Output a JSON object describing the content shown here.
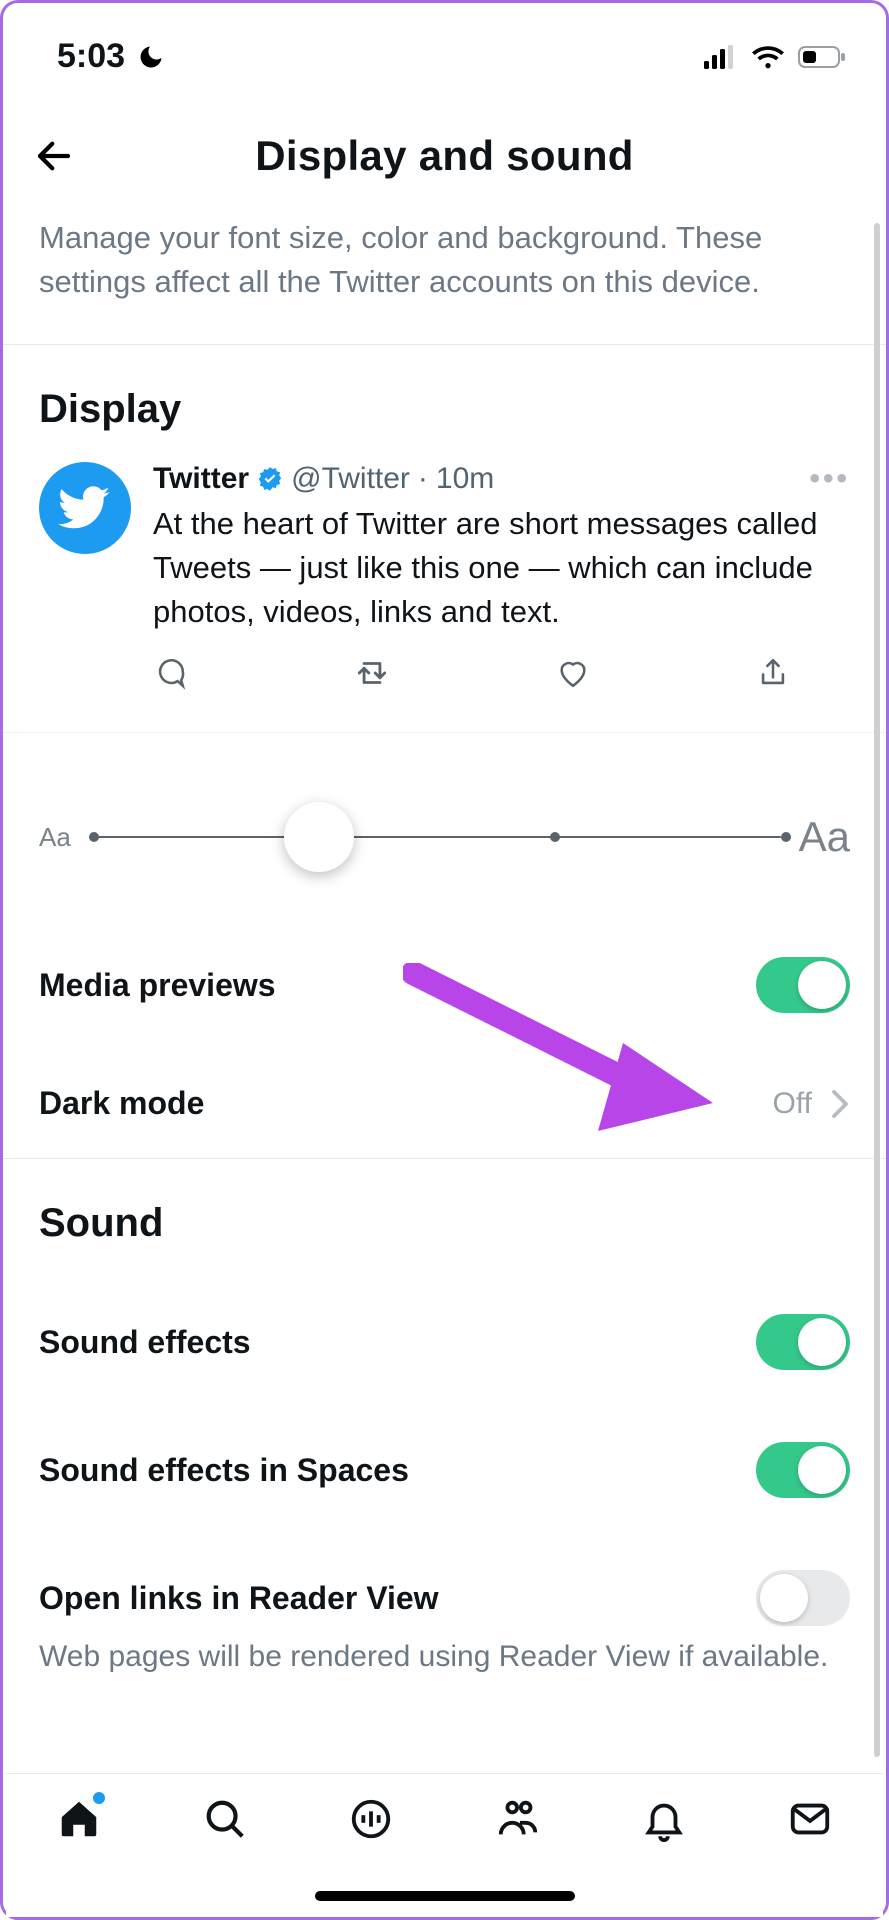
{
  "status": {
    "time": "5:03"
  },
  "header": {
    "title": "Display and sound"
  },
  "description": "Manage your font size, color and background. These settings affect all the Twitter accounts on this device.",
  "display": {
    "section_title": "Display",
    "tweet": {
      "name": "Twitter",
      "handle": "@Twitter",
      "time": "10m",
      "separator": "·",
      "body": "At the heart of Twitter are short messages called Tweets — just like this one — which can include photos, videos, links and text."
    },
    "font_slider": {
      "small_label": "Aa",
      "large_label": "Aa",
      "value_index": 1,
      "steps": 4
    },
    "media_previews": {
      "label": "Media previews",
      "on": true
    },
    "dark_mode": {
      "label": "Dark mode",
      "value": "Off"
    }
  },
  "sound": {
    "section_title": "Sound",
    "sound_effects": {
      "label": "Sound effects",
      "on": true
    },
    "spaces_sound": {
      "label": "Sound effects in Spaces",
      "on": true
    },
    "reader_view": {
      "label": "Open links in Reader View",
      "on": false,
      "helper": "Web pages will be rendered using Reader View if available."
    }
  },
  "annotations": {
    "arrow_target": "media_previews_toggle"
  },
  "colors": {
    "accent": "#1d9bf0",
    "toggle_on": "#34c98a",
    "arrow": "#b845e8"
  }
}
